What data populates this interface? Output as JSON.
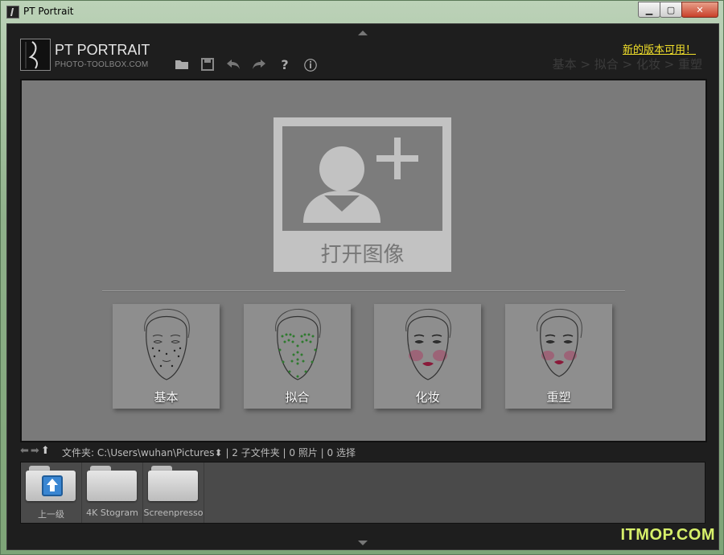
{
  "window": {
    "title": "PT Portrait",
    "controls": {
      "minimize": "minimize",
      "maximize": "maximize",
      "close": "close"
    }
  },
  "brand": {
    "name": "PT PORTRAIT",
    "site": "PHOTO-TOOLBOX.COM"
  },
  "toolbar": {
    "icons": [
      "folder-open-icon",
      "save-icon",
      "undo-icon",
      "redo-icon",
      "help-icon",
      "info-icon"
    ],
    "help_glyph": "?",
    "info_glyph": "ⓘ"
  },
  "update_link": "新的版本可用！",
  "steps": "基本 > 拟合 > 化妆 > 重塑",
  "open_image": {
    "label": "打开图像"
  },
  "modes": [
    {
      "label": "基本"
    },
    {
      "label": "拟合"
    },
    {
      "label": "化妆"
    },
    {
      "label": "重塑"
    }
  ],
  "status": {
    "folder_label": "文件夹:",
    "path": "C:\\Users\\wuhan\\Pictures",
    "path_arrow": "⬍",
    "summary": "| 2 子文件夹 | 0 照片 | 0 选择"
  },
  "files": [
    {
      "name": "上一级"
    },
    {
      "name": "4K Stogram"
    },
    {
      "name": "Screenpresso"
    }
  ],
  "watermark": "ITMOP.COM",
  "colors": {
    "update_link": "#f2e02a",
    "watermark": "#d7f06a"
  }
}
